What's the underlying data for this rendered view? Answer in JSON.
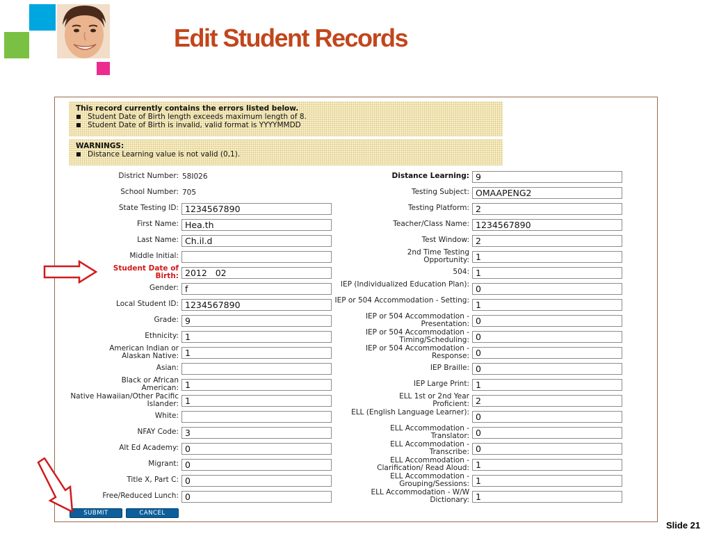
{
  "slide": {
    "title": "Edit Student Records",
    "number": "Slide 21"
  },
  "colors": {
    "title": "#c2461c",
    "highlight": "#d11b1b",
    "button": "#0c5f9c",
    "arrow": "#d11b1b"
  },
  "messages": {
    "errors": {
      "heading": "This record currently contains the errors listed below.",
      "items": [
        "Student Date of Birth length exceeds maximum length of 8.",
        "Student Date of Birth is invalid, valid format is YYYYMMDD"
      ]
    },
    "warnings": {
      "heading": "WARNINGS:",
      "items": [
        "Distance Learning value is not valid (0,1)."
      ]
    }
  },
  "left_fields": [
    {
      "label": "District Number:",
      "value": "58I026",
      "type": "static"
    },
    {
      "label": "School Number:",
      "value": "705",
      "type": "static"
    },
    {
      "label": "State Testing ID:",
      "value": "1234567890",
      "type": "input"
    },
    {
      "label": "First Name:",
      "value": "Hea.th",
      "type": "input"
    },
    {
      "label": "Last Name:",
      "value": "Ch.il.d",
      "type": "input"
    },
    {
      "label": "Middle Initial:",
      "value": "",
      "type": "input"
    },
    {
      "label": "Student Date of Birth:",
      "value": "2012   02",
      "type": "input",
      "highlight": true
    },
    {
      "label": "Gender:",
      "value": "f",
      "type": "input"
    },
    {
      "label": "Local Student ID:",
      "value": "1234567890",
      "type": "input"
    },
    {
      "label": "Grade:",
      "value": "9",
      "type": "input"
    },
    {
      "label": "Ethnicity:",
      "value": "1",
      "type": "input"
    },
    {
      "label": "American Indian or Alaskan Native:",
      "value": "1",
      "type": "input"
    },
    {
      "label": "Asian:",
      "value": "",
      "type": "input"
    },
    {
      "label": "Black or African American:",
      "value": "1",
      "type": "input"
    },
    {
      "label": "Native Hawaiian/Other Pacific Islander:",
      "value": "1",
      "type": "input"
    },
    {
      "label": "White:",
      "value": "",
      "type": "input"
    },
    {
      "label": "NFAY Code:",
      "value": "3",
      "type": "input"
    },
    {
      "label": "Alt Ed Academy:",
      "value": "0",
      "type": "input"
    },
    {
      "label": "Migrant:",
      "value": "0",
      "type": "input"
    },
    {
      "label": "Title X, Part C:",
      "value": "0",
      "type": "input"
    },
    {
      "label": "Free/Reduced Lunch:",
      "value": "0",
      "type": "input"
    }
  ],
  "right_fields": [
    {
      "label": "Distance Learning:",
      "value": "9",
      "bold": true
    },
    {
      "label": "Testing Subject:",
      "value": "OMAAPENG2"
    },
    {
      "label": "Testing Platform:",
      "value": "2"
    },
    {
      "label": "Teacher/Class Name:",
      "value": "1234567890"
    },
    {
      "label": "Test Window:",
      "value": "2"
    },
    {
      "label": "2nd Time Testing Opportunity:",
      "value": "1"
    },
    {
      "label": "504:",
      "value": "1"
    },
    {
      "label": "IEP (Individualized Education Plan):",
      "value": "0"
    },
    {
      "label": "IEP or 504 Accommodation - Setting:",
      "value": "1"
    },
    {
      "label": "IEP or 504 Accommodation - Presentation:",
      "value": "0"
    },
    {
      "label": "IEP or 504 Accommodation - Timing/Scheduling:",
      "value": "0"
    },
    {
      "label": "IEP or 504 Accommodation - Response:",
      "value": "0"
    },
    {
      "label": "IEP Braille:",
      "value": "0"
    },
    {
      "label": "IEP Large Print:",
      "value": "1"
    },
    {
      "label": "ELL 1st or 2nd Year Proficient:",
      "value": "2"
    },
    {
      "label": "ELL (English Language Learner):",
      "value": "0"
    },
    {
      "label": "ELL Accommodation - Translator:",
      "value": "0"
    },
    {
      "label": "ELL Accommodation - Transcribe:",
      "value": "0"
    },
    {
      "label": "ELL Accommodation - Clarification/ Read Aloud:",
      "value": "1"
    },
    {
      "label": "ELL Accommodation - Grouping/Sessions:",
      "value": "1"
    },
    {
      "label": "ELL Accommodation - W/W Dictionary:",
      "value": "1"
    }
  ],
  "buttons": {
    "submit": "SUBMIT",
    "cancel": "CANCEL"
  },
  "icons": {
    "arrow": "block-arrow-right",
    "photo": "smiling-man-photo"
  }
}
